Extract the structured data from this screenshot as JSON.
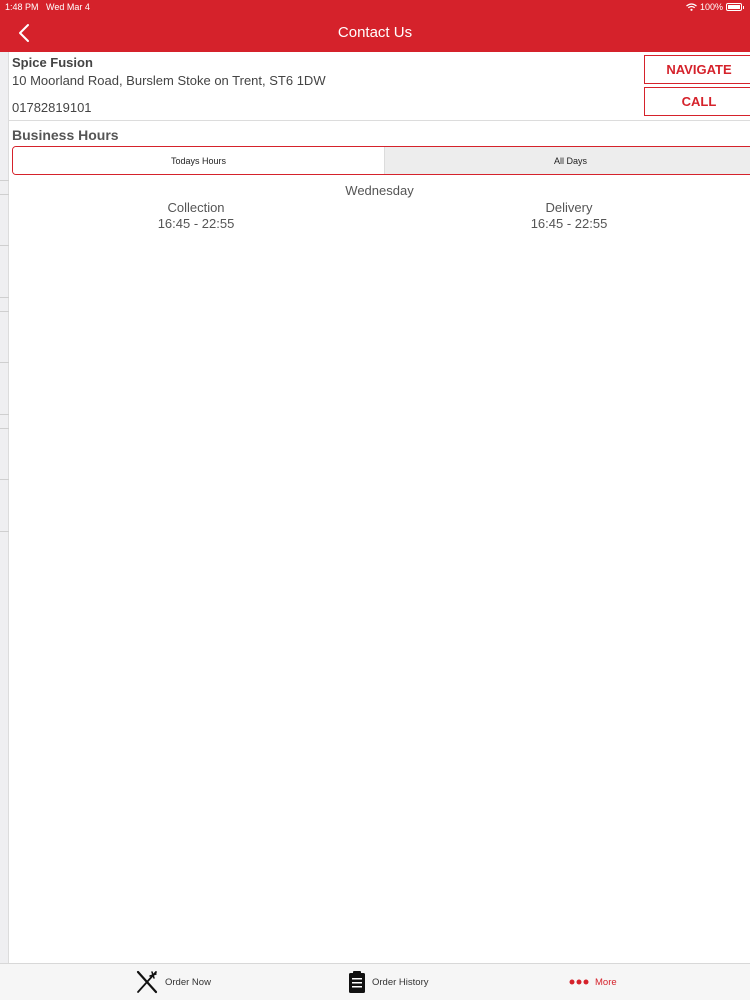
{
  "status_bar": {
    "time": "1:48 PM",
    "date": "Wed Mar 4",
    "battery": "100%",
    "wifi_icon": "wifi-icon"
  },
  "header": {
    "title": "Contact Us",
    "back_icon": "chevron-left-icon",
    "background_color": "#d5222b"
  },
  "contact": {
    "name": "Spice Fusion",
    "address": "10 Moorland Road, Burslem Stoke on Trent, ST6 1DW",
    "phone": "01782819101",
    "navigate_label": "NAVIGATE",
    "call_label": "CALL"
  },
  "business_hours": {
    "title": "Business Hours",
    "tabs": [
      {
        "label": "Todays Hours",
        "selected": true
      },
      {
        "label": "All Days",
        "selected": false
      }
    ],
    "day": "Wednesday",
    "columns": [
      {
        "label": "Collection",
        "hours": "16:45 - 22:55"
      },
      {
        "label": "Delivery",
        "hours": "16:45 - 22:55"
      }
    ]
  },
  "tabbar": {
    "items": [
      {
        "label": "Order Now",
        "icon": "fork-knife-icon"
      },
      {
        "label": "Order History",
        "icon": "clipboard-icon"
      },
      {
        "label": "More",
        "icon": "more-dots-icon",
        "active": true
      }
    ],
    "accent_color": "#d5222b"
  }
}
